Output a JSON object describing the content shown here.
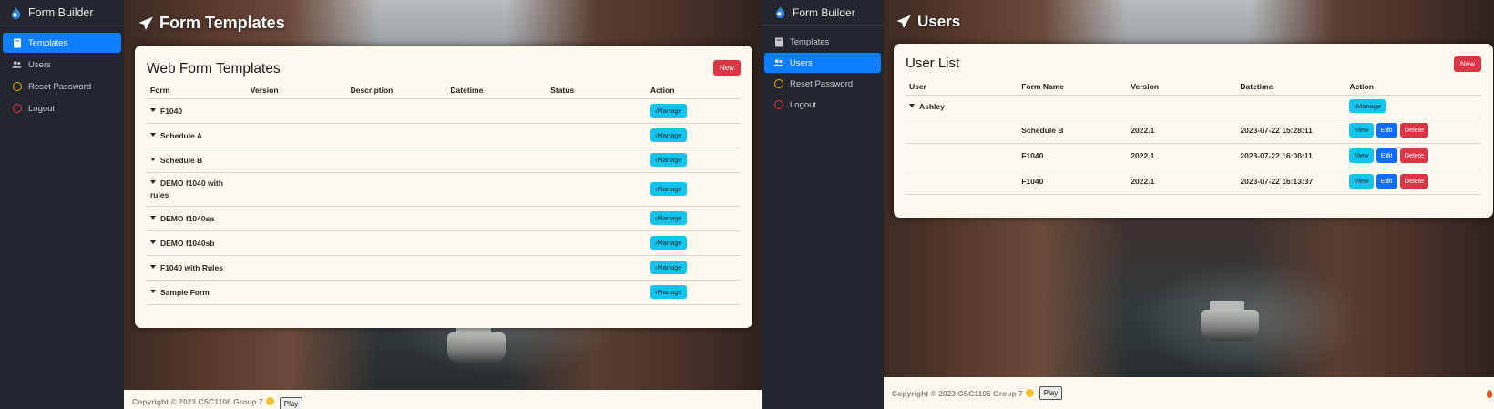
{
  "left": {
    "brand": "Form Builder",
    "nav": [
      {
        "label": "Templates",
        "icon": "book-icon",
        "active": true
      },
      {
        "label": "Users",
        "icon": "users-icon",
        "active": false
      },
      {
        "label": "Reset Password",
        "icon": "circle-icon",
        "active": false
      },
      {
        "label": "Logout",
        "icon": "circle-icon",
        "active": false
      }
    ],
    "page_title": "Form Templates",
    "card_title": "Web Form Templates",
    "new_label": "New",
    "columns": [
      "Form",
      "Version",
      "Description",
      "Datetime",
      "Status",
      "Action"
    ],
    "rows": [
      {
        "form": "F1040",
        "action": "Manage"
      },
      {
        "form": "Schedule A",
        "action": "Manage"
      },
      {
        "form": "Schedule B",
        "action": "Manage"
      },
      {
        "form": "DEMO f1040 with rules",
        "action": "Manage"
      },
      {
        "form": "DEMO f1040sa",
        "action": "Manage"
      },
      {
        "form": "DEMO f1040sb",
        "action": "Manage"
      },
      {
        "form": "F1040 with Rules",
        "action": "Manage"
      },
      {
        "form": "Sample Form",
        "action": "Manage"
      }
    ],
    "footer": {
      "text": "Copyright © 2023 CSC1106 Group 7",
      "play_label": "Play"
    }
  },
  "right": {
    "brand": "Form Builder",
    "nav": [
      {
        "label": "Templates",
        "icon": "book-icon",
        "active": false
      },
      {
        "label": "Users",
        "icon": "users-icon",
        "active": true
      },
      {
        "label": "Reset Password",
        "icon": "circle-icon",
        "active": false
      },
      {
        "label": "Logout",
        "icon": "circle-icon",
        "active": false
      }
    ],
    "page_title": "Users",
    "card_title": "User List",
    "new_label": "New",
    "columns": [
      "User",
      "Form Name",
      "Version",
      "Datetime",
      "Action"
    ],
    "group": {
      "user": "Ashley",
      "action": "Manage"
    },
    "rows": [
      {
        "form_name": "Schedule B",
        "version": "2022.1",
        "datetime": "2023-07-22 15:28:11"
      },
      {
        "form_name": "F1040",
        "version": "2022.1",
        "datetime": "2023-07-22 16:00:11"
      },
      {
        "form_name": "F1040",
        "version": "2022.1",
        "datetime": "2023-07-22 16:13:37"
      }
    ],
    "row_actions": {
      "view": "View",
      "edit": "Edit",
      "delete": "Delete"
    },
    "footer": {
      "text": "Copyright © 2023 CSC1106 Group 7",
      "play_label": "Play"
    }
  },
  "colors": {
    "sidebar_bg": "#23272d",
    "active_nav": "#0d7efe",
    "card_bg": "#fdf9ee",
    "new_button": "#dc3545",
    "manage_button": "#12c4ee",
    "edit_button": "#0d6efd",
    "delete_button": "#dc3545"
  }
}
